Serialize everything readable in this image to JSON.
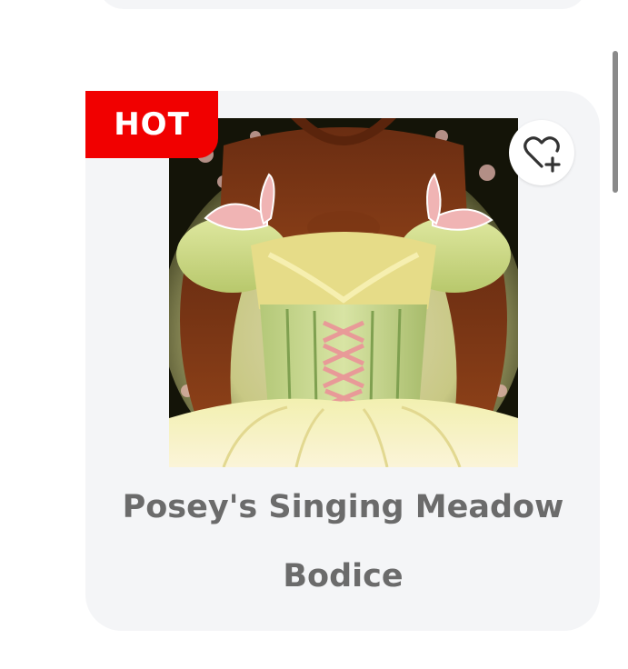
{
  "item": {
    "badge": "HOT",
    "name": "Posey's Singing Meadow Bodice"
  },
  "icons": {
    "favorite": "heart-plus-icon"
  },
  "colors": {
    "badge": "#f10000",
    "card": "#f4f5f7",
    "title": "#6b6b6b"
  }
}
